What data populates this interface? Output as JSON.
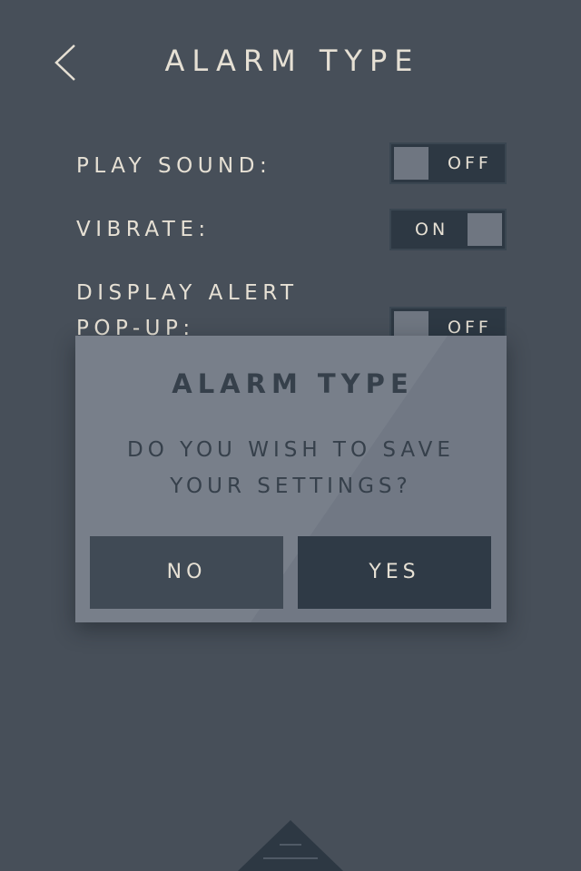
{
  "header": {
    "title": "ALARM TYPE",
    "back_icon": "chevron-left-icon"
  },
  "settings": [
    {
      "label": "PLAY SOUND:",
      "state": "OFF"
    },
    {
      "label": "VIBRATE:",
      "state": "ON"
    },
    {
      "label": "DISPLAY ALERT POP-UP:",
      "state": "OFF"
    }
  ],
  "dialog": {
    "title": "ALARM TYPE",
    "message": "DO YOU WISH TO SAVE YOUR SETTINGS?",
    "no_label": "NO",
    "yes_label": "YES"
  },
  "bottom_handle": {
    "icon": "menu-lines-icon"
  },
  "colors": {
    "background": "#474f59",
    "text": "#e6e0d4",
    "toggle_bg": "#2d3843",
    "toggle_knob": "#6f7681",
    "dialog_bg": "#717884",
    "dialog_text": "#36404b",
    "button_no": "#404a55",
    "button_yes": "#2f3a46"
  }
}
